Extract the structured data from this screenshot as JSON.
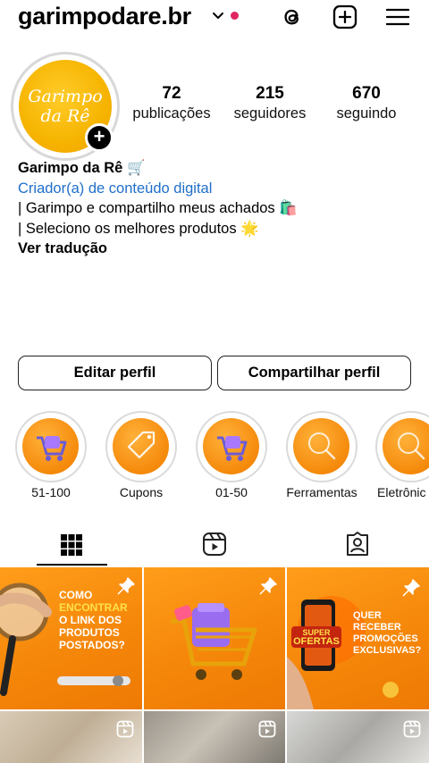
{
  "header": {
    "username": "garimpodare.br"
  },
  "profile": {
    "avatar_text_line1": "Garimpo",
    "avatar_text_line2": "da Rê",
    "add_badge": "+",
    "stats": [
      {
        "value": "72",
        "label": "publicações"
      },
      {
        "value": "215",
        "label": "seguidores"
      },
      {
        "value": "670",
        "label": "seguindo"
      }
    ],
    "name": "Garimpo da Rê 🛒",
    "category": "Criador(a) de conteúdo digital",
    "bio_line1": "| Garimpo e compartilho meus achados 🛍️",
    "bio_line2": "| Seleciono os melhores produtos 🌟",
    "translate": "Ver tradução"
  },
  "buttons": {
    "edit": "Editar perfil",
    "share": "Compartilhar perfil"
  },
  "highlights": [
    {
      "label": "51-100",
      "icon": "cart-icon"
    },
    {
      "label": "Cupons",
      "icon": "tag-icon"
    },
    {
      "label": "01-50",
      "icon": "cart-icon"
    },
    {
      "label": "Ferramentas",
      "icon": "magnifier-icon"
    },
    {
      "label": "Eletrônic",
      "icon": "magnifier-icon"
    }
  ],
  "posts": {
    "post1": {
      "l1": "COMO",
      "l2": "ENCONTRAR",
      "l3": "O LINK DOS",
      "l4": "PRODUTOS",
      "l5": "POSTADOS?"
    },
    "post3": {
      "badge1": "SUPER",
      "badge2": "OFERTAS",
      "l1": "QUER",
      "l2": "RECEBER",
      "l3": "PROMOÇÕES",
      "l4": "EXCLUSIVAS?"
    }
  },
  "colors": {
    "accent_link": "#1f6fc9",
    "notification": "#e0245e",
    "post_orange": "#f5870a",
    "post_yellow_text": "#ffe14a"
  }
}
